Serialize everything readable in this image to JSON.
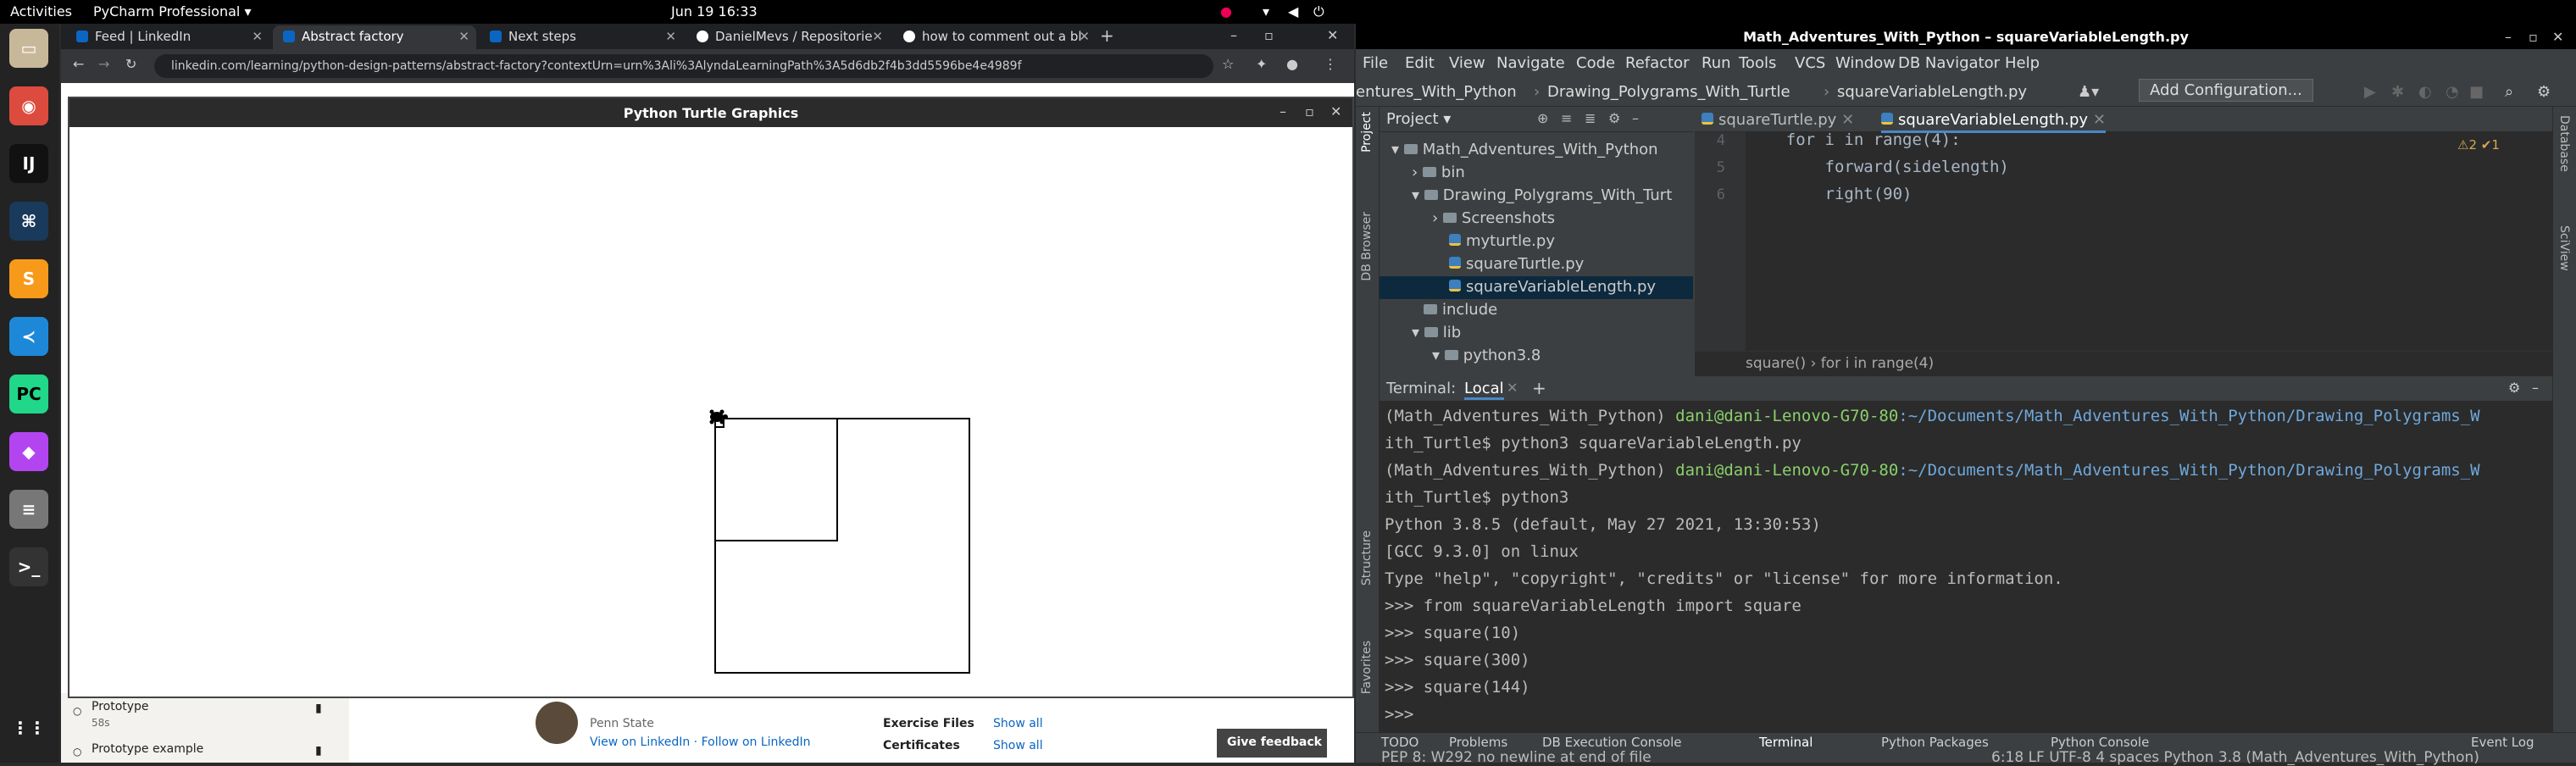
{
  "topbar": {
    "activities": "Activities",
    "app": "PyCharm Professional ▾",
    "clock": "Jun 19  16:33"
  },
  "dock": {
    "icons": [
      "files-icon",
      "chrome-icon",
      "intellij-icon",
      "pycharm-ce-icon",
      "sublime-icon",
      "vscode-icon",
      "pycharm-icon",
      "phpstorm-icon",
      "database-icon",
      "terminal-icon",
      "apps-grid-icon"
    ]
  },
  "chrome": {
    "tabs": [
      {
        "label": "Feed | LinkedIn",
        "color": "#0a66c2"
      },
      {
        "label": "Abstract factory",
        "color": "#0a66c2"
      },
      {
        "label": "Next steps",
        "color": "#0a66c2"
      },
      {
        "label": "DanielMevs / Repositorie",
        "color": "#ffffff"
      },
      {
        "label": "how to comment out a bl",
        "color": "#ffffff"
      }
    ],
    "url": "linkedin.com/learning/python-design-patterns/abstract-factory?contextUrn=urn%3Ali%3AlyndaLearningPath%3A5d6db2f4b3dd5596be4e4989f"
  },
  "linkedin": {
    "items": [
      {
        "title": "Prototype",
        "duration": "58s"
      },
      {
        "title": "Prototype example",
        "duration": ""
      }
    ],
    "author_school": "Penn State",
    "author_links": "View on LinkedIn · Follow on LinkedIn",
    "exercise_label": "Exercise Files",
    "certificates_label": "Certificates",
    "show_all": "Show all",
    "feedback": "Give feedback"
  },
  "turtle": {
    "title": "Python Turtle Graphics"
  },
  "pycharm": {
    "title": "Math_Adventures_With_Python – squareVariableLength.py",
    "menu": [
      "File",
      "Edit",
      "View",
      "Navigate",
      "Code",
      "Refactor",
      "Run",
      "Tools",
      "VCS",
      "Window",
      "DB Navigator",
      "Help"
    ],
    "nav": {
      "project": "entures_With_Python",
      "folder": "Drawing_Polygrams_With_Turtle",
      "file": "squareVariableLength.py",
      "config": "Add Configuration..."
    },
    "project_label": "Project ▾",
    "tree": [
      {
        "label": "Math_Adventures_With_Python",
        "indent": 0,
        "type": "folder"
      },
      {
        "label": "bin",
        "indent": 1,
        "type": "folder"
      },
      {
        "label": "Drawing_Polygrams_With_Turt",
        "indent": 1,
        "type": "folder"
      },
      {
        "label": "Screenshots",
        "indent": 2,
        "type": "folder"
      },
      {
        "label": "myturtle.py",
        "indent": 2,
        "type": "py"
      },
      {
        "label": "squareTurtle.py",
        "indent": 2,
        "type": "py"
      },
      {
        "label": "squareVariableLength.py",
        "indent": 2,
        "type": "py"
      },
      {
        "label": "include",
        "indent": 1,
        "type": "folder"
      },
      {
        "label": "lib",
        "indent": 1,
        "type": "folder"
      },
      {
        "label": "python3.8",
        "indent": 2,
        "type": "folder"
      }
    ],
    "editor_tabs": [
      "squareTurtle.py",
      "squareVariableLength.py"
    ],
    "code_lines": [
      {
        "num": "4",
        "text": "    for i in range(4):"
      },
      {
        "num": "5",
        "text": "        forward(sidelength)"
      },
      {
        "num": "6",
        "text": "        right(90)"
      }
    ],
    "inspection": "⚠2 ✔1",
    "breadcrumb": "square()  ›  for i in range(4)",
    "terminal_label": "Terminal:",
    "terminal_tab": "Local",
    "terminal_lines": [
      {
        "venv": "(Math_Adventures_With_Python) ",
        "user": "dani@dani-Lenovo-G70-80",
        "path": ":~/Documents/Math_Adventures_With_Python/Drawing_Polygrams_W"
      },
      {
        "text": "ith_Turtle$ python3 squareVariableLength.py"
      },
      {
        "venv": "(Math_Adventures_With_Python) ",
        "user": "dani@dani-Lenovo-G70-80",
        "path": ":~/Documents/Math_Adventures_With_Python/Drawing_Polygrams_W"
      },
      {
        "text": "ith_Turtle$ python3"
      },
      {
        "text": "Python 3.8.5 (default, May 27 2021, 13:30:53)"
      },
      {
        "text": "[GCC 9.3.0] on linux"
      },
      {
        "text": "Type \"help\", \"copyright\", \"credits\" or \"license\" for more information."
      },
      {
        "text": ">>> from squareVariableLength import square"
      },
      {
        "text": ">>> square(10)"
      },
      {
        "text": ">>> square(300)"
      },
      {
        "text": ">>> square(144)"
      },
      {
        "text": ">>> "
      }
    ],
    "left_strip": [
      "Project",
      "DB Browser",
      "Structure",
      "Favorites"
    ],
    "right_strip": [
      "Database",
      "SciView"
    ],
    "tool_tabs": [
      "TODO",
      "Problems",
      "DB Execution Console",
      "Terminal",
      "Python Packages",
      "Python Console"
    ],
    "event_log": "Event Log",
    "status_left": "PEP 8: W292 no newline at end of file",
    "status_right": "6:18  LF  UTF-8  4 spaces  Python 3.8 (Math_Adventures_With_Python)"
  }
}
